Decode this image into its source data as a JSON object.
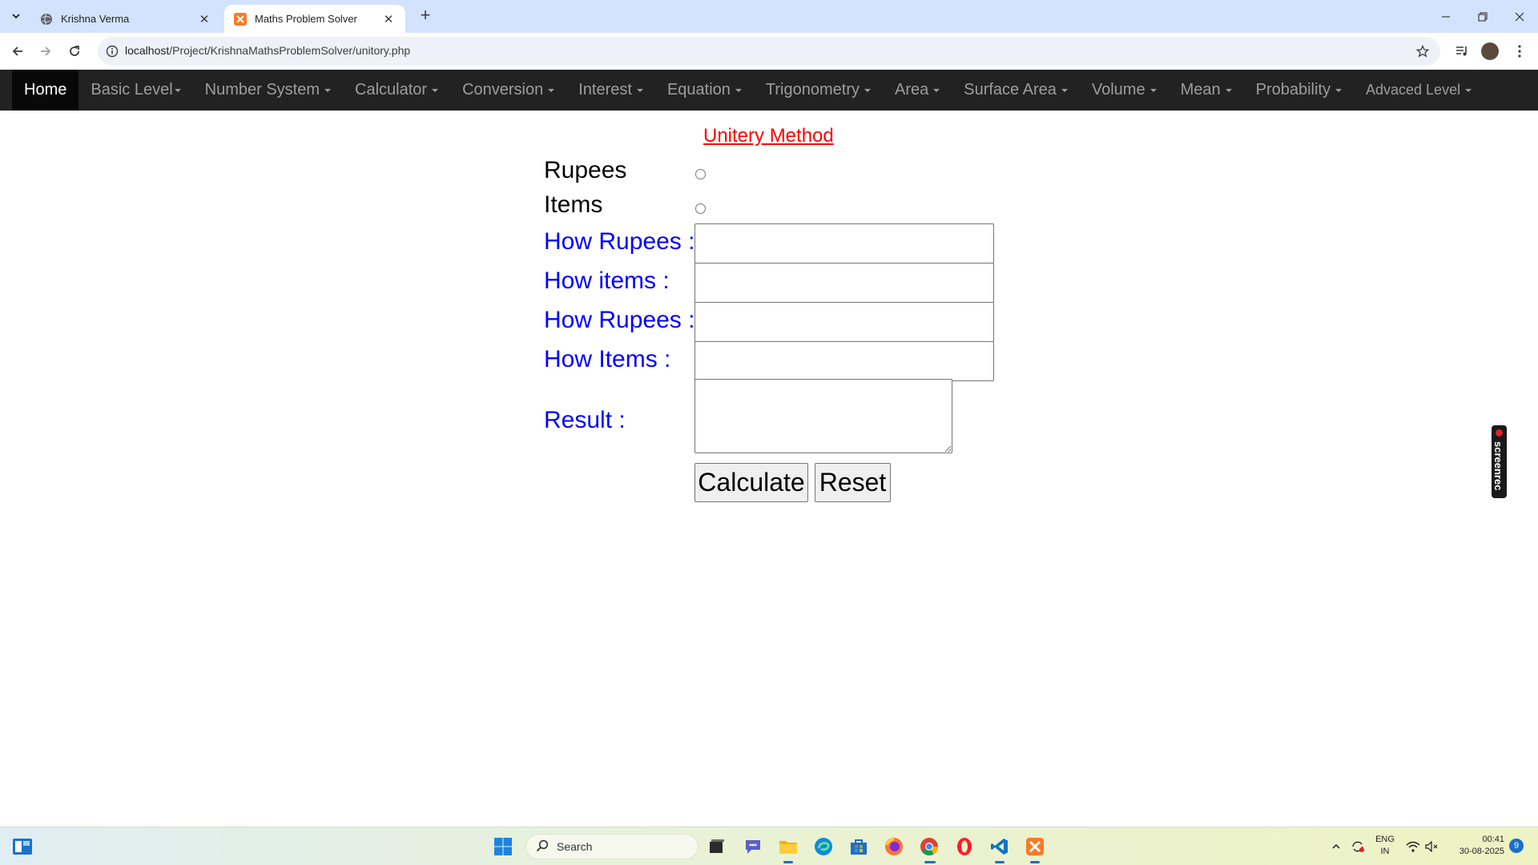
{
  "browser": {
    "tabs": [
      {
        "title": "Krishna Verma",
        "close": "✕"
      },
      {
        "title": "Maths Problem Solver",
        "close": "✕"
      }
    ],
    "new_tab": "+",
    "url_host": "localhost",
    "url_path": "/Project/KrishnaMathsProblemSolver/unitory.php"
  },
  "navbar": {
    "items": [
      {
        "label": "Home"
      },
      {
        "label": "Basic Level"
      },
      {
        "label": "Number System"
      },
      {
        "label": "Calculator"
      },
      {
        "label": "Conversion"
      },
      {
        "label": "Interest"
      },
      {
        "label": "Equation"
      },
      {
        "label": "Trigonometry"
      },
      {
        "label": "Area"
      },
      {
        "label": "Surface Area"
      },
      {
        "label": "Volume"
      },
      {
        "label": "Mean"
      },
      {
        "label": "Probability"
      },
      {
        "label": "Advaced Level"
      }
    ]
  },
  "form": {
    "title": "Unitery Method",
    "radio_rupees": "Rupees",
    "radio_items": "Items",
    "label_rupees_1": "How Rupees :",
    "label_items_1": "How items :",
    "label_rupees_2": "How Rupees :",
    "label_items_2": "How Items :",
    "label_result": "Result :",
    "value_rupees_1": "",
    "value_items_1": "",
    "value_rupees_2": "",
    "value_items_2": "",
    "value_result": "",
    "calculate_label": "Calculate",
    "reset_label": "Reset"
  },
  "overlay": {
    "screenrec": "screenrec"
  },
  "taskbar": {
    "search_placeholder": "Search",
    "language": "ENG",
    "region": "IN",
    "time": "00:41",
    "date": "30-08-2025",
    "notification_count": "9"
  },
  "colors": {
    "navbar_bg": "#222222",
    "navbar_active_bg": "#080808",
    "title_red": "#ff0000",
    "label_blue": "#0000ff",
    "tabstrip": "#d3e3fd"
  }
}
